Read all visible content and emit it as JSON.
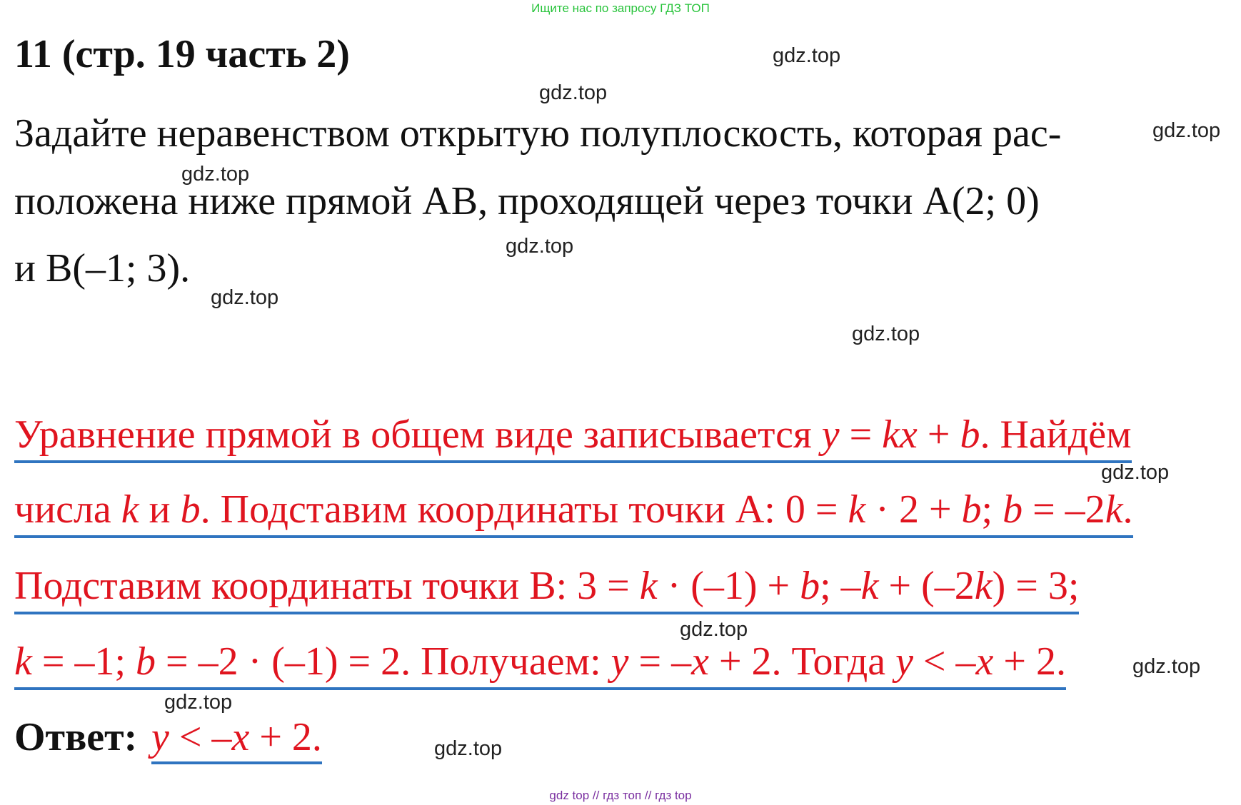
{
  "top_banner": "Ищите нас по запросу ГДЗ ТОП",
  "title": "11 (стр. 19 часть 2)",
  "task": {
    "lines": [
      "Задайте неравенством открытую полуплоскость, которая рас-",
      "положена ниже прямой AB, проходящей через точки A(2; 0)",
      "и B(–1; 3)."
    ]
  },
  "solution": {
    "line1": {
      "p1": "Уравнение прямой в общем виде записывается ",
      "i1": "y",
      "p2": " = ",
      "i2": "kx",
      "p3": " + ",
      "i3": "b",
      "p4": ". Найдём"
    },
    "line2": {
      "p1": "числа ",
      "i1": "k",
      "p2": " и ",
      "i2": "b",
      "p3": ". Подставим координаты точки A: 0 = ",
      "i3": "k",
      "p4": " · 2 + ",
      "i4": "b",
      "p5": "; ",
      "i5": "b",
      "p6": " = –2",
      "i6": "k",
      "p7": "."
    },
    "line3": {
      "p1": "Подставим координаты точки B: 3 = ",
      "i1": "k",
      "p2": " · (–1) + ",
      "i2": "b",
      "p3": "; –",
      "i3": "k",
      "p4": " + (–2",
      "i4": "k",
      "p5": ") = 3;"
    },
    "line4": {
      "i1": "k",
      "p1": " = –1; ",
      "i2": "b",
      "p2": " = –2 · (–1) = 2. Получаем: ",
      "i3": "y",
      "p3": " = –",
      "i4": "x",
      "p4": " + 2. Тогда ",
      "i5": "y",
      "p5": " < –",
      "i6": "x",
      "p6": " + 2."
    }
  },
  "answer": {
    "label": "Ответ:",
    "i1": "y",
    "p1": " < –",
    "i2": "x",
    "p2": " + 2."
  },
  "watermarks": [
    "gdz.top",
    "gdz.top",
    "gdz.top",
    "gdz.top",
    "gdz.top",
    "gdz.top",
    "gdz.top",
    "gdz.top",
    "gdz.top",
    "gdz.top",
    "gdz.top",
    "gdz.top"
  ],
  "bottom_banner": "gdz top  //  гдз топ  //  гдз top",
  "colors": {
    "solution_text": "#e0141f",
    "underline": "#2f74c0",
    "top_banner": "#27c33a",
    "bottom_banner": "#7a2fa0"
  }
}
